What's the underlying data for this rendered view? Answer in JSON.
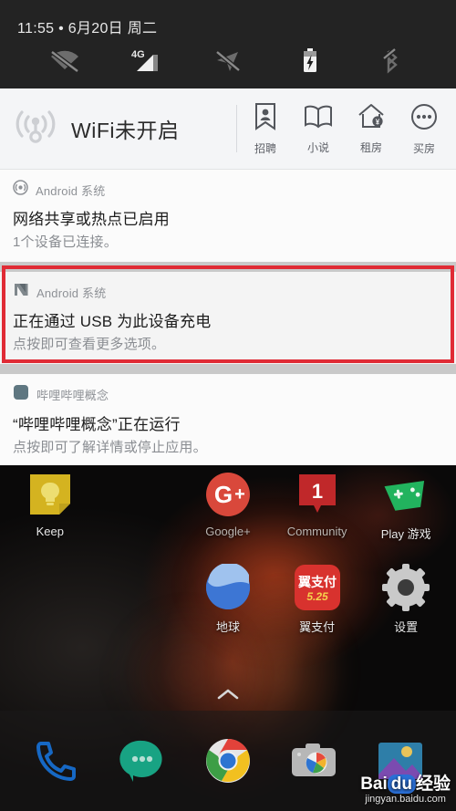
{
  "statusbar": {
    "time": "11:55",
    "separator": "•",
    "date": "6月20日 周二",
    "icons": [
      {
        "name": "wifi-off-icon",
        "state": "off"
      },
      {
        "name": "cellular-4g-icon",
        "label": "4G",
        "state": "on"
      },
      {
        "name": "location-off-icon",
        "state": "off"
      },
      {
        "name": "battery-charging-icon",
        "state": "charging"
      },
      {
        "name": "bluetooth-off-icon",
        "state": "off"
      }
    ]
  },
  "quick_header": {
    "wifi_icon": "wifi-broadcast-icon",
    "wifi_status": "WiFi未开启",
    "shortcuts": [
      {
        "icon": "person-banner-icon",
        "label": "招聘"
      },
      {
        "icon": "open-book-icon",
        "label": "小说"
      },
      {
        "icon": "house-coin-icon",
        "label": "租房"
      },
      {
        "icon": "dots-circle-icon",
        "label": "买房"
      }
    ]
  },
  "notifications": [
    {
      "app_icon": "hotspot-icon",
      "app": "Android 系统",
      "title": "网络共享或热点已启用",
      "text": "1个设备已连接。",
      "highlighted": false
    },
    {
      "app_icon": "android-n-icon",
      "app": "Android 系统",
      "title": "正在通过 USB 为此设备充电",
      "text": "点按即可查看更多选项。",
      "highlighted": true
    },
    {
      "app_icon": "bilibili-concept-icon",
      "app": "哔哩哔哩概念",
      "title": "“哔哩哔哩概念”正在运行",
      "text": "点按即可了解详情或停止应用。",
      "highlighted": false
    }
  ],
  "highlight": {
    "color": "#e02b35"
  },
  "home": {
    "rows": [
      [
        {
          "icon": "keep-icon",
          "label": "Keep"
        },
        {
          "icon": "blank-icon",
          "label": ""
        },
        {
          "icon": "google-plus-icon",
          "label": "Google+"
        },
        {
          "icon": "community-icon",
          "label": "Community"
        },
        {
          "icon": "play-games-icon",
          "label": "Play 游戏"
        }
      ],
      [
        {
          "icon": "blank-icon",
          "label": ""
        },
        {
          "icon": "blank-icon",
          "label": ""
        },
        {
          "icon": "earth-icon",
          "label": "地球"
        },
        {
          "icon": "bestpay-icon",
          "label": "翼支付",
          "badge": "5.25"
        },
        {
          "icon": "settings-gear-icon",
          "label": "设置"
        }
      ]
    ],
    "page_indicator": "app-drawer-chevron",
    "dock": [
      {
        "icon": "phone-icon",
        "label": "电话"
      },
      {
        "icon": "messages-icon",
        "label": "短信"
      },
      {
        "icon": "chrome-icon",
        "label": "Chrome"
      },
      {
        "icon": "camera-icon",
        "label": "相机"
      },
      {
        "icon": "photos-icon",
        "label": "照片"
      }
    ]
  },
  "watermark": {
    "brand_a": "Bai",
    "brand_b": "du",
    "brand_c": "经验",
    "url": "jingyan.baidu.com"
  }
}
